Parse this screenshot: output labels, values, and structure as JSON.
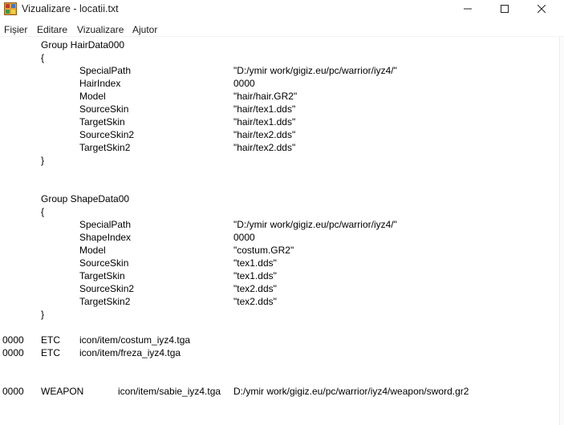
{
  "window": {
    "title": "Vizualizare - locatii.txt"
  },
  "icons": {
    "app": "notepad-app-icon",
    "minimize": "minimize-icon",
    "maximize": "maximize-icon",
    "close": "close-icon"
  },
  "menu": {
    "items": [
      "Fișier",
      "Editare",
      "Vizualizare",
      "Ajutor"
    ]
  },
  "document": {
    "hair_group": {
      "header": "Group HairData000",
      "open_brace": "{",
      "close_brace": "}",
      "entries": [
        {
          "key": "SpecialPath",
          "value": "\"D:/ymir work/gigiz.eu/pc/warrior/iyz4/\""
        },
        {
          "key": "HairIndex",
          "value": "0000"
        },
        {
          "key": "Model",
          "value": "\"hair/hair.GR2\""
        },
        {
          "key": "SourceSkin",
          "value": "\"hair/tex1.dds\""
        },
        {
          "key": "TargetSkin",
          "value": "\"hair/tex1.dds\""
        },
        {
          "key": "SourceSkin2",
          "value": "\"hair/tex2.dds\""
        },
        {
          "key": "TargetSkin2",
          "value": "\"hair/tex2.dds\""
        }
      ]
    },
    "shape_group": {
      "header": "Group ShapeData00",
      "open_brace": "{",
      "close_brace": "}",
      "entries": [
        {
          "key": "SpecialPath",
          "value": "\"D:/ymir work/gigiz.eu/pc/warrior/iyz4/\""
        },
        {
          "key": "ShapeIndex",
          "value": "0000"
        },
        {
          "key": "Model",
          "value": "\"costum.GR2\""
        },
        {
          "key": "SourceSkin",
          "value": "\"tex1.dds\""
        },
        {
          "key": "TargetSkin",
          "value": "\"tex1.dds\""
        },
        {
          "key": "SourceSkin2",
          "value": "\"tex2.dds\""
        },
        {
          "key": "TargetSkin2",
          "value": "\"tex2.dds\""
        }
      ]
    },
    "etc_lines": [
      {
        "index": "0000",
        "type": "ETC",
        "path": "icon/item/costum_iyz4.tga"
      },
      {
        "index": "0000",
        "type": "ETC",
        "path": "icon/item/freza_iyz4.tga"
      }
    ],
    "weapon_line": {
      "index": "0000",
      "type": "WEAPON",
      "icon": "icon/item/sabie_iyz4.tga",
      "path": "D:/ymir work/gigiz.eu/pc/warrior/iyz4/weapon/sword.gr2"
    }
  }
}
